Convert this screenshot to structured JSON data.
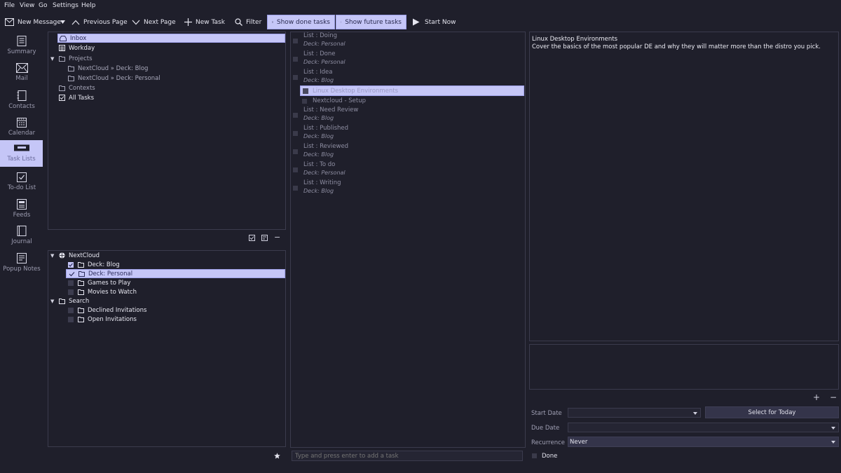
{
  "menu": [
    "File",
    "View",
    "Go",
    "Settings",
    "Help"
  ],
  "toolbar": {
    "new_message": "New Message",
    "previous_page": "Previous Page",
    "next_page": "Next Page",
    "new_task": "New Task",
    "filter": "Filter",
    "show_done": "Show done tasks",
    "show_future": "Show future tasks",
    "start_now": "Start Now"
  },
  "nav": {
    "summary": "Summary",
    "mail": "Mail",
    "contacts": "Contacts",
    "calendar": "Calendar",
    "task_lists": "Task Lists",
    "todo": "To-do List",
    "feeds": "Feeds",
    "journal": "Journal",
    "popup_notes": "Popup Notes"
  },
  "views_tree": {
    "inbox": "Inbox",
    "workday": "Workday",
    "projects": "Projects",
    "project_blog": "NextCloud » Deck: Blog",
    "project_personal": "NextCloud » Deck: Personal",
    "contexts": "Contexts",
    "all_tasks": "All Tasks"
  },
  "sources_tree": {
    "nextcloud": "NextCloud",
    "deck_blog": "Deck: Blog",
    "deck_personal": "Deck: Personal",
    "games": "Games to Play",
    "movies": "Movies to Watch",
    "search": "Search",
    "declined": "Declined Invitations",
    "open": "Open Invitations"
  },
  "tasks": [
    {
      "title": "List : Doing",
      "sub": "Deck: Personal"
    },
    {
      "title": "List : Done",
      "sub": "Deck: Personal"
    },
    {
      "title": "List : Idea",
      "sub": "Deck: Blog"
    },
    {
      "title": "Linux Desktop Environments",
      "sub": ""
    },
    {
      "title": "Nextcloud - Setup",
      "sub": ""
    },
    {
      "title": "List : Need Review",
      "sub": "Deck: Blog"
    },
    {
      "title": "List : Published",
      "sub": "Deck: Blog"
    },
    {
      "title": "List : Reviewed",
      "sub": "Deck: Blog"
    },
    {
      "title": "List : To do",
      "sub": "Deck: Personal"
    },
    {
      "title": "List : Writing",
      "sub": "Deck: Blog"
    }
  ],
  "add_task_placeholder": "Type and press enter to add a task",
  "detail": {
    "title": "Linux Desktop Environments",
    "description": "Cover the basics of the most popular DE and why they will matter more than the distro you pick."
  },
  "props": {
    "start_date_label": "Start Date",
    "start_date_value": "",
    "select_today": "Select for Today",
    "due_date_label": "Due Date",
    "due_date_value": "",
    "recurrence_label": "Recurrence",
    "recurrence_value": "Never",
    "done_label": "Done"
  },
  "colors": {
    "background": "#1f1f2b",
    "accent": "#c5c6f7",
    "border": "#3b3b4d"
  }
}
